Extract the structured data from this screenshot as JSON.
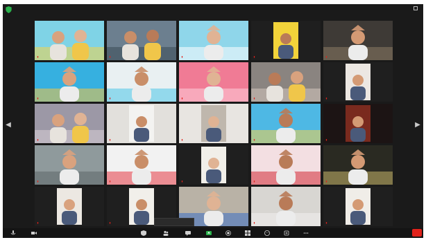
{
  "app": {
    "title": ""
  },
  "colors": {
    "background": "#1a1a1a",
    "toolbar": "#141414",
    "accent_green": "#2bb24c",
    "end_red": "#e0221b"
  },
  "icons": {
    "security": "shield-icon",
    "view": "grid-view-icon",
    "prev": "chevron-left-icon",
    "next": "chevron-right-icon"
  },
  "view_toggle": {
    "label": ""
  },
  "participants": [
    {
      "name": ""
    },
    {
      "name": ""
    },
    {
      "name": ""
    },
    {
      "name": ""
    },
    {
      "name": ""
    },
    {
      "name": ""
    },
    {
      "name": ""
    },
    {
      "name": ""
    },
    {
      "name": ""
    },
    {
      "name": ""
    },
    {
      "name": ""
    },
    {
      "name": ""
    },
    {
      "name": ""
    },
    {
      "name": ""
    },
    {
      "name": ""
    },
    {
      "name": ""
    },
    {
      "name": ""
    },
    {
      "name": ""
    },
    {
      "name": ""
    },
    {
      "name": ""
    },
    {
      "name": ""
    },
    {
      "name": ""
    },
    {
      "name": ""
    },
    {
      "name": ""
    },
    {
      "name": ""
    }
  ],
  "notification": {
    "text": ""
  },
  "toolbar": {
    "buttons": [
      {
        "icon": "microphone-icon"
      },
      {
        "icon": "video-camera-icon"
      },
      {
        "icon": "security-icon"
      },
      {
        "icon": "participants-icon"
      },
      {
        "icon": "chat-icon"
      },
      {
        "icon": "share-screen-icon"
      },
      {
        "icon": "record-icon"
      },
      {
        "icon": "breakout-rooms-icon"
      },
      {
        "icon": "reactions-icon"
      },
      {
        "icon": "apps-icon"
      },
      {
        "icon": "more-icon"
      }
    ],
    "end_label": ""
  }
}
